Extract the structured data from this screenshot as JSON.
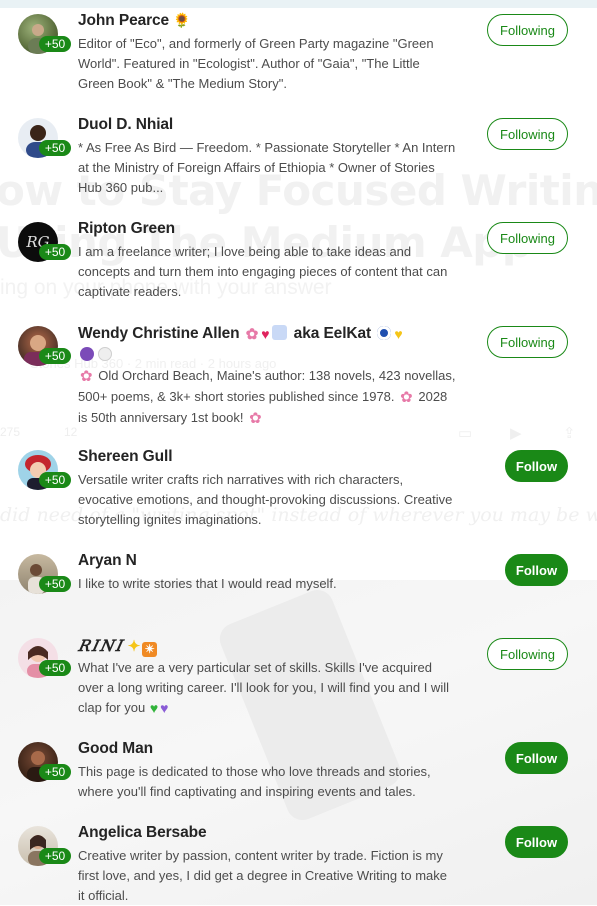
{
  "background": {
    "title_line1": "ow to Stay Focused Writing When",
    "title_line2": "Using The Medium App",
    "subtitle": "ing on your phone with your answer",
    "meta": "Stories Hub 360 · 2 min read · 2 hours ago",
    "claps": "275",
    "responses": "12",
    "quote": "did need of a \"writing spot\" instead of wherever you may be writing"
  },
  "users": [
    {
      "name": "John Pearce",
      "name_emoji": "🌻",
      "badge": "+50",
      "bio": "Editor of \"Eco\", and formerly of Green Party magazine \"Green World\". Featured in \"Ecologist\". Author of \"Gaia\", \"The Little Green Book\" & \"The Medium Story\".",
      "button": "Following"
    },
    {
      "name": "Duol D. Nhial",
      "badge": "+50",
      "bio": "* As Free As Bird — Freedom. * Passionate Storyteller * An Intern at the Ministry of Foreign Affairs of Ethiopia * Owner of Stories Hub 360 pub...",
      "button": "Following"
    },
    {
      "name": "Ripton Green",
      "avatar_initials": "RG",
      "badge": "+50",
      "bio": "I am a freelance writer; I love being able to take ideas and concepts and turn them into engaging pieces of content that can captivate readers.",
      "button": "Following"
    },
    {
      "name": "Wendy Christine Allen",
      "name_suffix": "aka EelKat",
      "badge": "+50",
      "bio_1": "Old Orchard Beach, Maine's author: 138 novels, 423 novellas, 500+ poems, & 3k+ short stories published since 1978.",
      "bio_2": "2028 is 50th anniversary 1st book!",
      "button": "Following"
    },
    {
      "name": "Shereen Gull",
      "badge": "+50",
      "bio": "Versatile writer crafts rich narratives with rich characters, evocative emotions, and thought-provoking discussions. Creative storytelling ignites imaginations.",
      "button": "Follow"
    },
    {
      "name": "Aryan N",
      "badge": "+50",
      "bio": "I like to write stories that I would read myself.",
      "button": "Follow"
    },
    {
      "name": "𝑅𝐼𝑁𝐼",
      "badge": "+50",
      "bio": "What I've are a very particular set of skills. Skills I've acquired over a long writing career. I'll look for you, I will find you and I will clap for you",
      "button": "Following"
    },
    {
      "name": "Good Man",
      "badge": "+50",
      "bio": "This page is dedicated to those who love threads and stories, where you'll find captivating and inspiring events and tales.",
      "button": "Follow"
    },
    {
      "name": "Angelica Bersabe",
      "badge": "+50",
      "bio": "Creative writer by passion, content writer by trade. Fiction is my first love, and yes, I did get a degree in Creative Writing to make it official.",
      "button": "Follow"
    }
  ],
  "colors": {
    "accent_green": "#1a8917",
    "text_primary": "#242424",
    "text_secondary": "#4c4c4c"
  }
}
